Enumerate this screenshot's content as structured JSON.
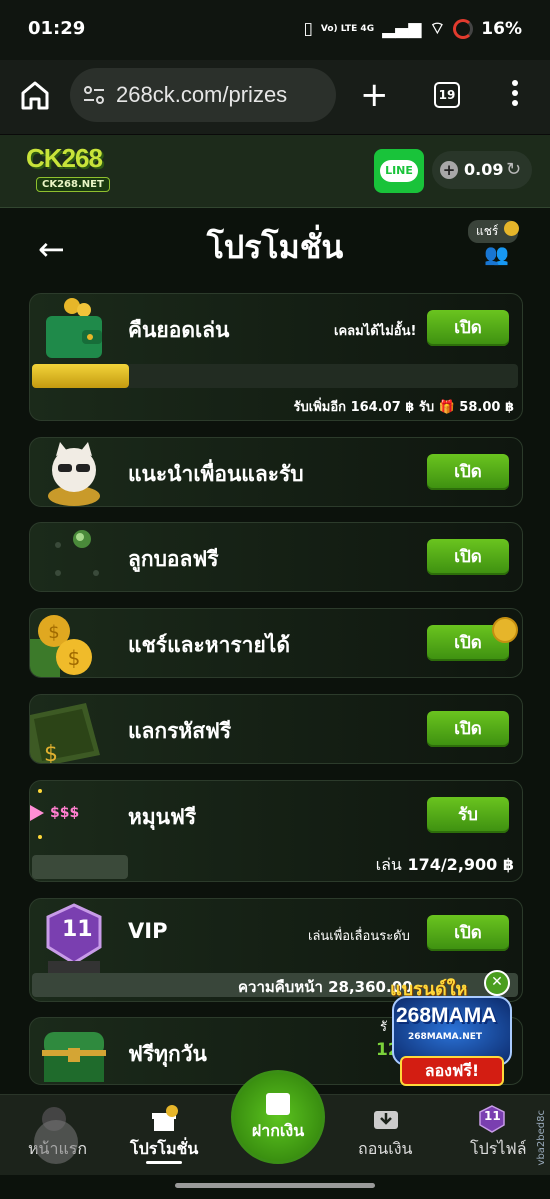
{
  "status_bar": {
    "time": "01:29",
    "network": "Vo) LTE 4G",
    "battery": "16%"
  },
  "browser": {
    "url": "268ck.com/prizes",
    "tab_count": "19"
  },
  "site_header": {
    "logo_text": "CK268",
    "logo_sub": "CK268.NET",
    "line_label": "LINE",
    "balance": "0.09"
  },
  "page": {
    "title": "โปรโมชั่น",
    "share_label": "แชร์"
  },
  "cards": {
    "rebate": {
      "title": "คืนยอดเล่น",
      "note": "เคลมได้ไม่อั้น!",
      "button": "เปิด",
      "footer": "รับเพิ่มอีก 164.07 ฿ รับ 🎁 58.00 ฿",
      "progress": 0.2
    },
    "referral": {
      "title": "แนะนำเพื่อนและรับ",
      "button": "เปิด"
    },
    "freeball": {
      "title": "ลูกบอลฟรี",
      "button": "เปิด"
    },
    "share": {
      "title": "แชร์และหารายได้",
      "button": "เปิด"
    },
    "code": {
      "title": "แลกรหัสฟรี",
      "button": "เปิด"
    },
    "spin": {
      "title": "หมุนฟรี",
      "button": "รับ",
      "icon_text": "$$$",
      "footer_prefix": "เล่น",
      "footer_value": "174/2,900 ฿",
      "progress": 0.06
    },
    "vip": {
      "title": "VIP",
      "badge": "11",
      "note": "เล่นเพื่อเลื่อนระดับ",
      "button": "เปิด",
      "footer": "ความคืบหน้า 28,360.00",
      "progress": 0.0
    },
    "daily": {
      "title": "ฟรีทุกวัน",
      "note": "รั",
      "value": "12"
    }
  },
  "bottom_nav": {
    "home": "หน้าแรก",
    "promotions": "โปรโมชั่น",
    "deposit": "ฝากเงิน",
    "withdraw": "ถอนเงิน",
    "profile": "โปรไฟล์",
    "profile_badge": "11"
  },
  "ad": {
    "top_text": "แบรนด์ให",
    "brand": "268MAMA",
    "site": "268MAMA.NET",
    "cta": "ลองฟรี!",
    "close": "✕"
  },
  "version_tag": "vba2bed8c",
  "colors": {
    "accent_green": "#4fa818",
    "gold": "#e6b52a",
    "background": "#0c120c"
  }
}
